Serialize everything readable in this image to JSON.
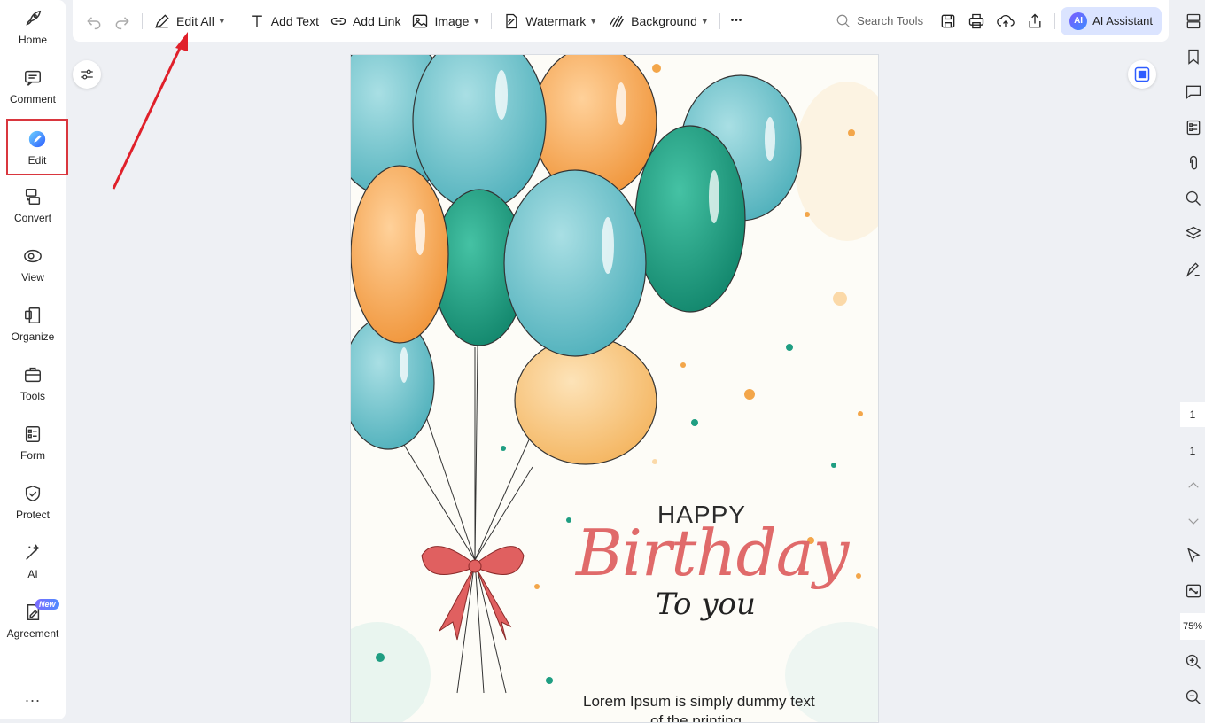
{
  "sidebar": {
    "items": [
      {
        "label": "Home",
        "icon": "rocket-icon"
      },
      {
        "label": "Comment",
        "icon": "comment-icon"
      },
      {
        "label": "Edit",
        "icon": "edit-icon"
      },
      {
        "label": "Convert",
        "icon": "convert-icon"
      },
      {
        "label": "View",
        "icon": "eye-icon"
      },
      {
        "label": "Organize",
        "icon": "organize-icon"
      },
      {
        "label": "Tools",
        "icon": "toolbox-icon"
      },
      {
        "label": "Form",
        "icon": "form-icon"
      },
      {
        "label": "Protect",
        "icon": "shield-icon"
      },
      {
        "label": "AI",
        "icon": "magic-wand-icon"
      },
      {
        "label": "Agreement",
        "icon": "agreement-icon",
        "badge": "New"
      }
    ],
    "more": "..."
  },
  "toolbar": {
    "edit_all": "Edit All",
    "add_text": "Add Text",
    "add_link": "Add Link",
    "image": "Image",
    "watermark": "Watermark",
    "background": "Background",
    "more": "•••",
    "search_tools": "Search Tools",
    "ai_logo": "AI",
    "ai_assistant": "AI Assistant"
  },
  "document": {
    "happy": "HAPPY",
    "birthday": "Birthday",
    "to_you": "To you",
    "body_line1": "Lorem Ipsum is simply dummy text",
    "body_line2": "of the printing"
  },
  "pagination": {
    "current_page": "1",
    "total_pages": "1",
    "zoom": "75%"
  },
  "colors": {
    "accent": "#d9363e",
    "ai_bg": "#dbe4ff",
    "birthday_text": "#e06a6a",
    "balloon_teal": "#6cc3cc",
    "balloon_orange": "#f3a64a",
    "balloon_green": "#1f9e82"
  }
}
